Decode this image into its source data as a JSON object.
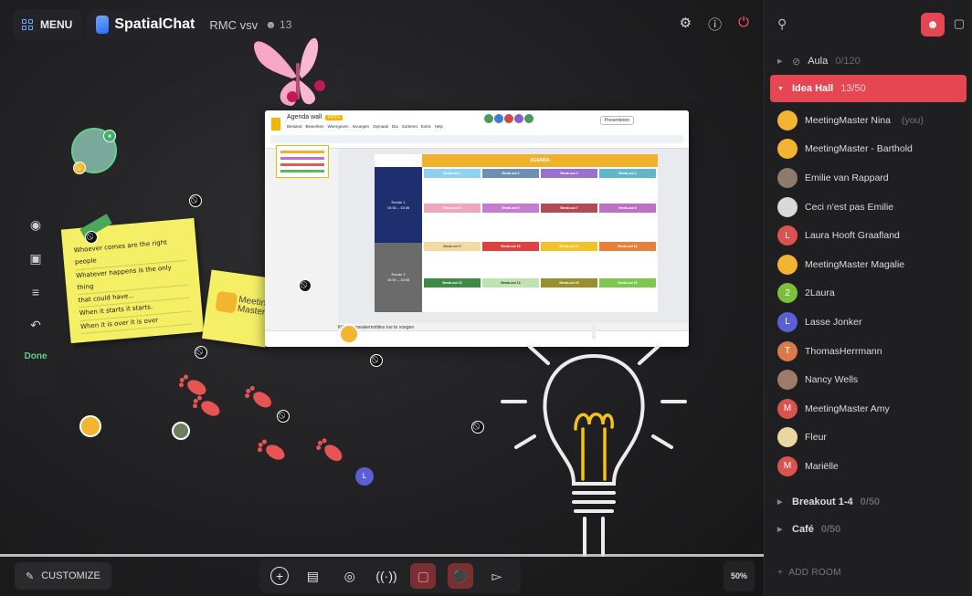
{
  "topbar": {
    "menu_label": "MENU",
    "brand": "SpatialChat",
    "room": "RMC vsv",
    "participants": "13"
  },
  "left_toolbar": {
    "done_label": "Done"
  },
  "sticky_note": {
    "lines": [
      "Whoever comes are the right people",
      "Whatever happens is the only thing",
      "that could have...",
      "When it starts it starts.",
      "When it is over it is over"
    ]
  },
  "sticky_logo_text": "Meeting Master",
  "slides": {
    "doc_title": "Agenda wall",
    "doc_badge": "PPTX",
    "menu": [
      "Bestand",
      "Bewerken",
      "Weergeven",
      "Invoegen",
      "Opmaak",
      "Dia",
      "Sorteren",
      "Extra",
      "Help"
    ],
    "present_label": "Presenteren",
    "agenda_header": "AGENDA",
    "ronde1": "Ronde 1\n15:30 – 15:45",
    "ronde2": "Ronde 2\n15:50 – 16:05",
    "cells": [
      "Break-out 1",
      "Break-out 2",
      "Break-out 3",
      "Break-out 4",
      "Break-out 5",
      "Break-out 6",
      "Break-out 7",
      "Break-out 8",
      "Break-out 9",
      "Break-out 10",
      "Break-out 11",
      "Break-out 12",
      "Break-out 13",
      "Break-out 14",
      "Break-out 15",
      "Break-out 16"
    ],
    "speaker_notes": "Klik om speakernotities toe te voegen"
  },
  "canvas_avatar_letter": "L",
  "bottom": {
    "customize_label": "CUSTOMIZE",
    "zoom": "50%"
  },
  "sidebar": {
    "rooms_top": [
      {
        "name": "Aula",
        "count": "0/120"
      }
    ],
    "active_room": {
      "name": "Idea Hall",
      "count": "13/50"
    },
    "users": [
      {
        "name": "MeetingMaster Nina",
        "you": "(you)",
        "avatar": "logo",
        "color": "#f3b431"
      },
      {
        "name": "MeetingMaster - Barthold",
        "avatar": "logo",
        "color": "#f3b431"
      },
      {
        "name": "Emilie van Rappard",
        "avatar": "photo",
        "color": "#8c7b6d"
      },
      {
        "name": "Ceci n'est pas Emilie",
        "avatar": "photo",
        "color": "#d9d9d9"
      },
      {
        "name": "Laura Hooft Graafland",
        "avatar": "L",
        "color": "#d9534f"
      },
      {
        "name": "MeetingMaster Magalie",
        "avatar": "logo",
        "color": "#f3b431"
      },
      {
        "name": "2Laura",
        "avatar": "2",
        "color": "#7bbf3a"
      },
      {
        "name": "Lasse Jonker",
        "avatar": "L",
        "color": "#5b5fd6"
      },
      {
        "name": "ThomasHerrmann",
        "avatar": "T",
        "color": "#d97a4a"
      },
      {
        "name": "Nancy Wells",
        "avatar": "photo",
        "color": "#a07a68"
      },
      {
        "name": "MeetingMaster Amy",
        "avatar": "M",
        "color": "#d9534f"
      },
      {
        "name": "Fleur",
        "avatar": "photo",
        "color": "#e8d7a0"
      },
      {
        "name": "Mariëlle",
        "avatar": "M",
        "color": "#d9534f"
      }
    ],
    "rooms_bottom": [
      {
        "name": "Breakout 1-4",
        "count": "0/50"
      },
      {
        "name": "Café",
        "count": "0/50"
      }
    ],
    "add_room_label": "ADD ROOM"
  },
  "colors": {
    "accent": "#e64552",
    "agenda_yellow": "#f0b12b",
    "ronde1": "#1d2f6e",
    "ronde2": "#6b6b6b"
  }
}
